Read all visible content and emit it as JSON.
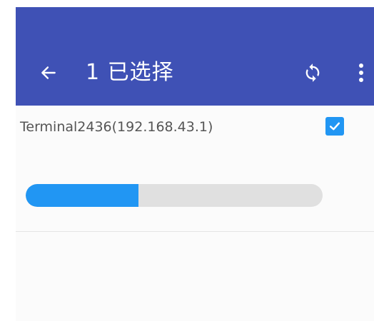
{
  "app_bar": {
    "title": "1 已选择",
    "back_icon": "arrow-left-icon",
    "refresh_icon": "sync-icon",
    "menu_icon": "more-vertical-icon",
    "color": "#3f51b5"
  },
  "device": {
    "label": "Terminal2436(192.168.43.1)",
    "checked": true,
    "progress": 0.38,
    "accent_color": "#2196f3"
  }
}
